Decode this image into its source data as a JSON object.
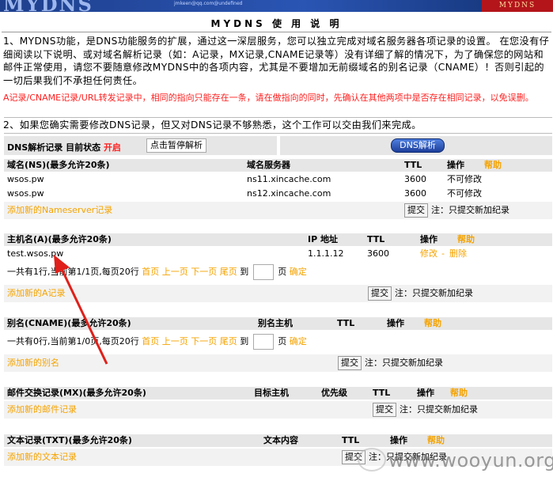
{
  "banner": {
    "logo": "MYDNS",
    "tag": "MYDNS",
    "sub": "jmkeen@qq.com@undefined"
  },
  "title": "MYDNS 使 用 说 明",
  "intro": {
    "p1": "1、MYDNS功能，是DNS功能服务的扩展，通过这一深层服务，您可以独立完成对域名服务器各项记录的设置。 在您没有仔细阅读以下说明、或对域名解析记录（如：A记录，MX记录,CNAME记录等）没有详细了解的情况下，为了确保您的网站和邮件正常使用，请您不要随意修改MYDNS中的各项内容，尤其是不要增加无前缀域名的别名记录（CNAME）！否则引起的一切后果我们不承担任何责任。",
    "warning": "A记录/CNAME记录/URL转发记录中，相同的指向只能存在一条，请在做指向的同时，先确认在其他两项中是否存在相同记录，以免误删。",
    "p2": "2、如果您确实需要修改DNS记录，但又对DNS记录不够熟悉，这个工作可以交由我们来完成。"
  },
  "status": {
    "label": "DNS解析记录 目前状态",
    "value": "开启",
    "pause_button": "点击暂停解析",
    "dns_button": "DNS解析"
  },
  "ns": {
    "headers": [
      "域名(NS)(最多允许20条)",
      "域名服务器",
      "TTL",
      "操作",
      "帮助"
    ],
    "rows": [
      {
        "domain": "wsos.pw",
        "server": "ns11.xincache.com",
        "ttl": "3600",
        "op": "不可修改"
      },
      {
        "domain": "wsos.pw",
        "server": "ns12.xincache.com",
        "ttl": "3600",
        "op": "不可修改"
      }
    ],
    "add_link": "添加新的Nameserver记录",
    "submit": "提交",
    "note": "注：只提交新加纪录"
  },
  "a": {
    "headers": [
      "主机名(A)(最多允许20条)",
      "IP 地址",
      "TTL",
      "操作",
      "帮助"
    ],
    "rows": [
      {
        "host": "test.wsos.pw",
        "ip": "1.1.1.12",
        "ttl": "3600",
        "edit": "修改",
        "sep": "-",
        "delete": "删除"
      }
    ],
    "pager": {
      "summary": "一共有1行,当前第1/1页,每页20行",
      "first": "首页",
      "prev": "上一页",
      "next": "下一页",
      "last": "尾页",
      "to": "到",
      "page": "页",
      "confirm": "确定"
    },
    "add_link": "添加新的A记录",
    "submit": "提交",
    "note": "注：只提交新加纪录"
  },
  "cname": {
    "headers": [
      "别名(CNAME)(最多允许20条)",
      "别名主机",
      "TTL",
      "操作",
      "帮助"
    ],
    "pager": {
      "summary": "一共有0行,当前第1/0页,每页20行",
      "first": "首页",
      "prev": "上一页",
      "next": "下一页",
      "last": "尾页",
      "to": "到",
      "page": "页",
      "confirm": "确定"
    },
    "add_link": "添加新的别名",
    "submit": "提交",
    "note": "注：只提交新加纪录"
  },
  "mx": {
    "headers": [
      "邮件交换记录(MX)(最多允许20条)",
      "目标主机",
      "优先级",
      "TTL",
      "操作",
      "帮助"
    ],
    "add_link": "添加新的邮件记录",
    "submit": "提交",
    "note": "注：只提交新加纪录"
  },
  "txt": {
    "headers": [
      "文本记录(TXT)(最多允许20条)",
      "文本内容",
      "TTL",
      "操作",
      "帮助"
    ],
    "add_link": "添加新的文本记录",
    "submit": "提交",
    "note": "注：只提交新加纪录"
  },
  "watermark": "www.wooyun.org",
  "colors": {
    "accent_orange": "#f5a300",
    "warning_red": "#ff1f1f",
    "header_gray": "#e6e6e6",
    "banner_blue": "#2a55b3"
  }
}
